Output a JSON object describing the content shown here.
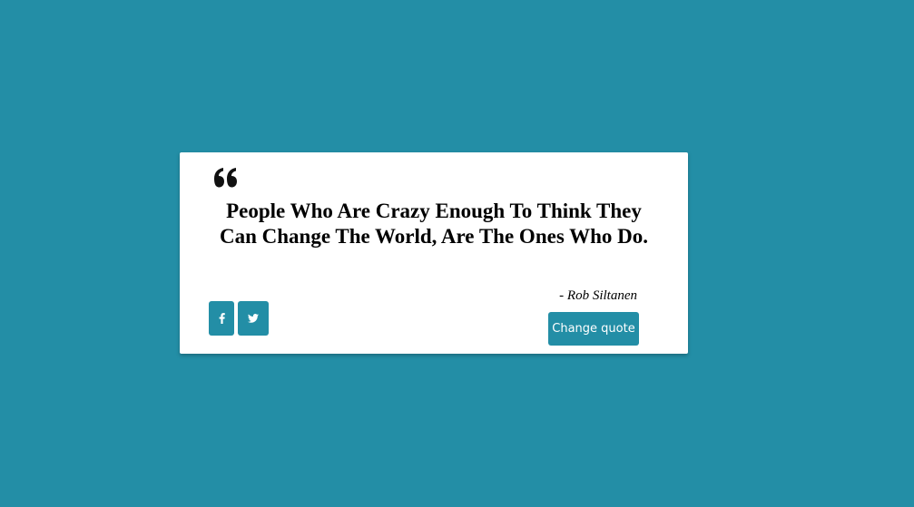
{
  "colors": {
    "background": "#238ea6",
    "card": "#ffffff",
    "accent": "#238ea6",
    "text": "#000000"
  },
  "quote": {
    "icon": "quote-left-icon",
    "text": "People Who Are Crazy Enough To Think They Can Change The World, Are The Ones Who Do.",
    "author": "- Rob Siltanen"
  },
  "actions": {
    "facebook_icon": "facebook-icon",
    "twitter_icon": "twitter-icon",
    "change_label": "Change quote"
  }
}
